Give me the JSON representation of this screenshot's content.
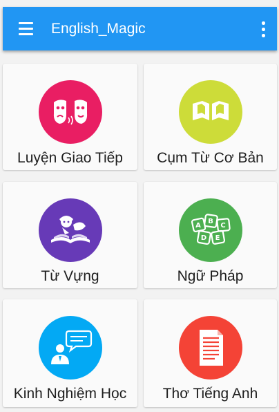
{
  "app_bar": {
    "title": "English_Magic",
    "menu_icon": "hamburger-menu-icon",
    "overflow_icon": "more-vertical-icon",
    "color": "#2196f3"
  },
  "menu": [
    {
      "label": "Luyện Giao Tiếp",
      "icon": "theater-masks-icon",
      "color": "#e91e63"
    },
    {
      "label": "Cụm Từ Cơ Bản",
      "icon": "open-book-icon",
      "color": "#cddc39"
    },
    {
      "label": "Từ Vựng",
      "icon": "reading-person-icon",
      "color": "#673ab7"
    },
    {
      "label": "Ngữ Pháp",
      "icon": "abc-blocks-icon",
      "color": "#4caf50"
    },
    {
      "label": "Kinh Nghiệm Học",
      "icon": "person-speech-bubble-icon",
      "color": "#03a9f4"
    },
    {
      "label": "Thơ Tiếng Anh",
      "icon": "document-icon",
      "color": "#f44336"
    }
  ]
}
